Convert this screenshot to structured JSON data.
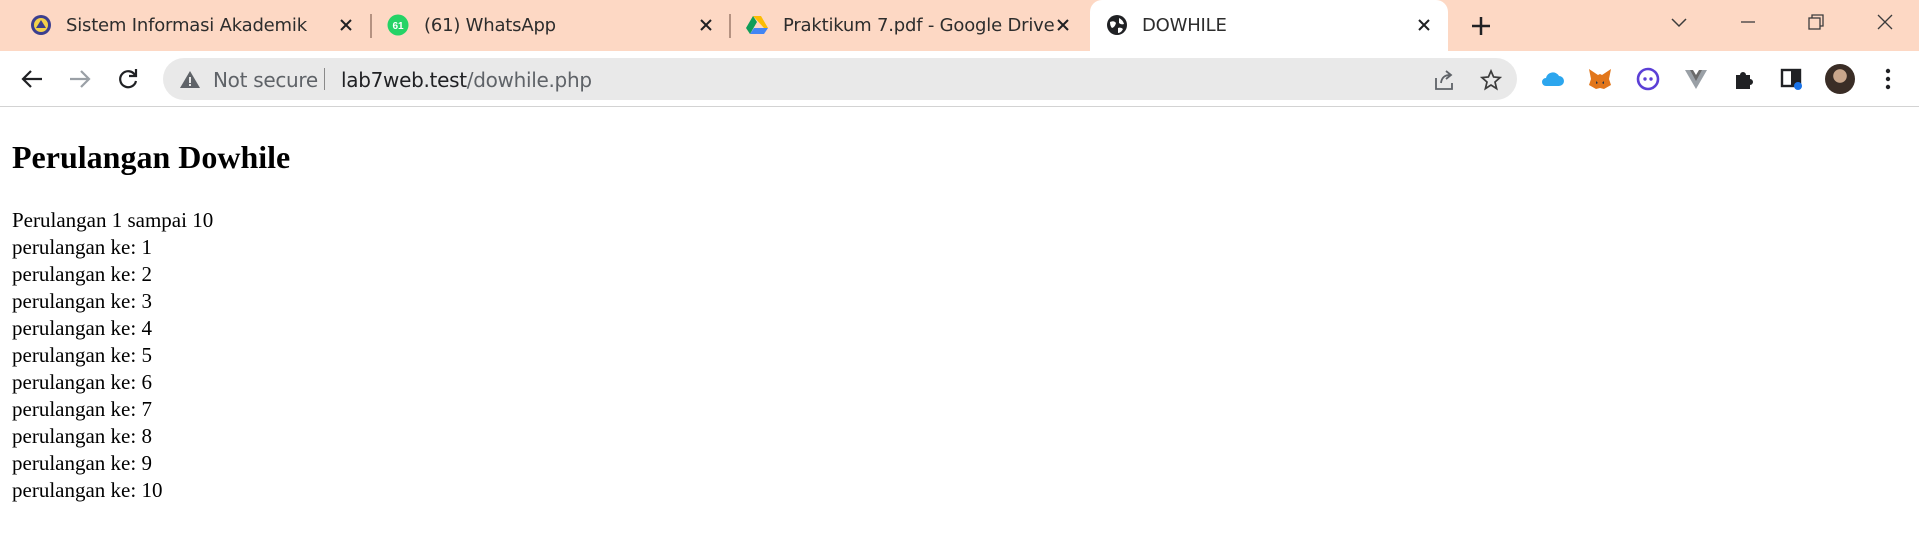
{
  "tabs": [
    {
      "title": "Sistem Informasi Akademik",
      "favicon": "university-seal-icon"
    },
    {
      "title": "(61) WhatsApp",
      "favicon": "whatsapp-icon",
      "badge": "61"
    },
    {
      "title": "Praktikum 7.pdf - Google Drive",
      "favicon": "google-drive-icon"
    },
    {
      "title": "DOWHILE",
      "favicon": "globe-icon",
      "active": true
    }
  ],
  "address_bar": {
    "security_label": "Not secure",
    "host": "lab7web.test",
    "path": "/dowhile.php"
  },
  "colors": {
    "tabstrip_bg": "#fdd8c4",
    "omnibox_bg": "#e9e9e9",
    "text": "#000000"
  },
  "page": {
    "heading": "Perulangan Dowhile",
    "lines": [
      "Perulangan 1 sampai 10",
      "perulangan ke: 1",
      "perulangan ke: 2",
      "perulangan ke: 3",
      "perulangan ke: 4",
      "perulangan ke: 5",
      "perulangan ke: 6",
      "perulangan ke: 7",
      "perulangan ke: 8",
      "perulangan ke: 9",
      "perulangan ke: 10"
    ]
  }
}
